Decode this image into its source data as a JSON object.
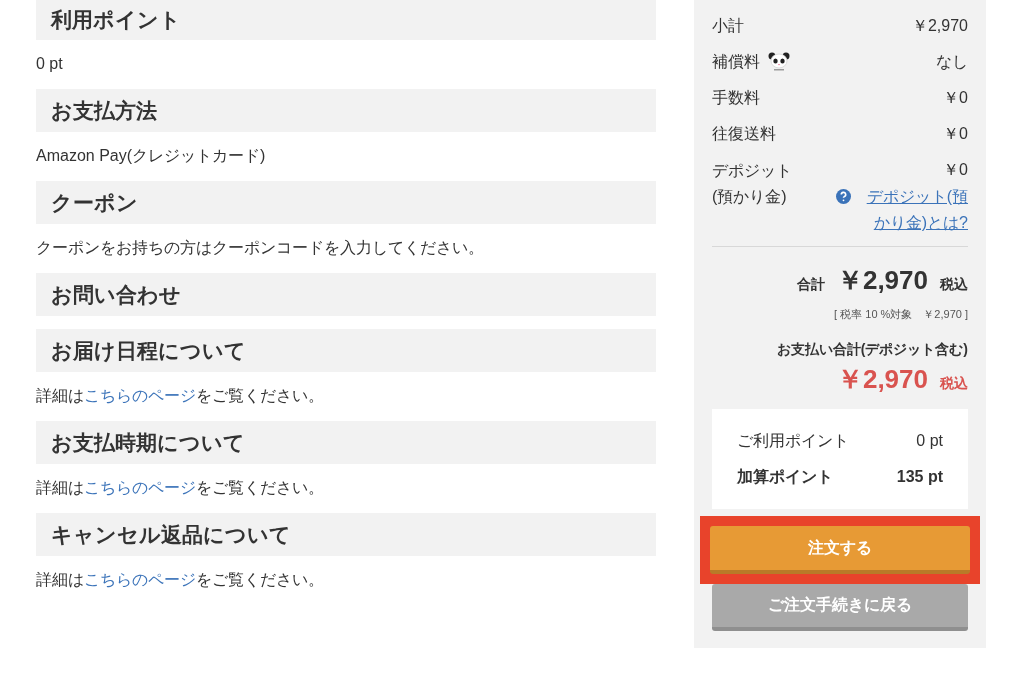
{
  "sections": [
    {
      "heading": "利用ポイント",
      "body": [
        {
          "text": "0 pt"
        }
      ]
    },
    {
      "heading": "お支払方法",
      "body": [
        {
          "text": "Amazon Pay(クレジットカード)"
        }
      ]
    },
    {
      "heading": "クーポン",
      "body": [
        {
          "text": "クーポンをお持ちの方はクーポンコードを入力してください。"
        }
      ]
    },
    {
      "heading": "お問い合わせ"
    },
    {
      "heading": "お届け日程について",
      "body": [
        {
          "text": "詳細は"
        },
        {
          "text": "こちらのページ",
          "link": true
        },
        {
          "text": "をご覧ください。"
        }
      ]
    },
    {
      "heading": "お支払時期について",
      "body": [
        {
          "text": "詳細は"
        },
        {
          "text": "こちらのページ",
          "link": true
        },
        {
          "text": "をご覧ください。"
        }
      ]
    },
    {
      "heading": "キャンセル返品について",
      "body": [
        {
          "text": "詳細は"
        },
        {
          "text": "こちらのページ",
          "link": true
        },
        {
          "text": "をご覧ください。"
        }
      ]
    }
  ],
  "summary": {
    "rows": [
      {
        "label": "小計",
        "value": "￥2,970"
      },
      {
        "label": "補償料",
        "value": "なし",
        "kind": "panda"
      },
      {
        "label": "手数料",
        "value": "￥0"
      },
      {
        "label": "往復送料",
        "value": "￥0"
      },
      {
        "label": "デポジット(預かり金)",
        "value": "￥0",
        "help_link": "デポジット(預かり金)とは?"
      }
    ],
    "total_label": "合計",
    "total": "￥2,970",
    "tax_suffix": "税込",
    "tax_note": "[ 税率 10 %対象　￥2,970 ]",
    "payment_label": "お支払い合計(デポジット含む)",
    "payment_total": "￥2,970",
    "payment_suffix": "税込",
    "points": [
      {
        "label": "ご利用ポイント",
        "value": "0 pt",
        "bold": false
      },
      {
        "label": "加算ポイント",
        "value": "135 pt",
        "bold": true
      }
    ],
    "order_button": {
      "label": "注文する",
      "highlighted": true
    },
    "back_button": {
      "label": "ご注文手続きに戻る",
      "disabled": true
    }
  }
}
